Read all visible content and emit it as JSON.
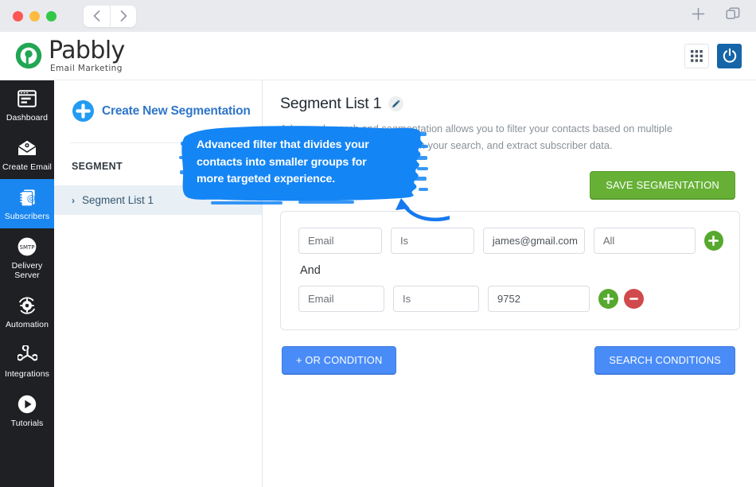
{
  "titlebar": {
    "back_icon": "chevron-left-icon",
    "forward_icon": "chevron-right-icon",
    "new_tab_icon": "plus-icon",
    "tabs_icon": "copy-tabs-icon"
  },
  "brand": {
    "name": "Pabbly",
    "tagline": "Email Marketing",
    "grid_icon": "apps-grid-icon",
    "power_icon": "power-icon"
  },
  "rail": {
    "items": [
      {
        "label": "Dashboard",
        "icon": "dashboard-icon",
        "active": false
      },
      {
        "label": "Create Email",
        "icon": "envelope-icon",
        "active": false
      },
      {
        "label": "Subscribers",
        "icon": "contacts-icon",
        "active": true
      },
      {
        "label": "Delivery Server",
        "icon": "smtp-icon",
        "active": false
      },
      {
        "label": "Automation",
        "icon": "gear-automation-icon",
        "active": false
      },
      {
        "label": "Integrations",
        "icon": "integrations-icon",
        "active": false
      },
      {
        "label": "Tutorials",
        "icon": "play-icon",
        "active": false
      }
    ]
  },
  "sidebar": {
    "create_label": "Create New Segmentation",
    "create_icon": "plus-circle-icon",
    "section_header": "SEGMENT",
    "items": [
      {
        "label": "Segment List 1",
        "chevron": "›",
        "selected": true
      }
    ]
  },
  "main": {
    "title": "Segment List 1",
    "edit_icon": "pencil-icon",
    "description_line1": "Advanced search and segmentation allows you to filter your contacts based on multiple",
    "description_line2": "conditions, create new lists from your search, and extract subscriber data.",
    "save_button": "SAVE SEGMENTATION",
    "or_condition_button": "+ OR CONDITION",
    "search_button": "SEARCH CONDITIONS",
    "and_label": "And",
    "conditions": [
      {
        "field": "Email",
        "operator": "Is",
        "value": "james@gmail.com",
        "list": "All",
        "add_icon": "plus-circle-green-icon",
        "remove_icon": null
      },
      {
        "field": "Email",
        "operator": "Is",
        "value": "9752",
        "list": null,
        "add_icon": "plus-circle-green-icon",
        "remove_icon": "minus-circle-red-icon"
      }
    ]
  },
  "annotation": {
    "line1": "Advanced filter that divides your",
    "line2": "contacts into smaller groups for",
    "line3": "more targeted experience.",
    "arrow_icon": "curved-arrow-icon",
    "highlight_color": "#1485f5"
  },
  "colors": {
    "rail_bg": "#1f2023",
    "accent_blue": "#1a86f0",
    "green": "#66b135",
    "red": "#d0494c",
    "button_blue": "#4a8cf7"
  }
}
